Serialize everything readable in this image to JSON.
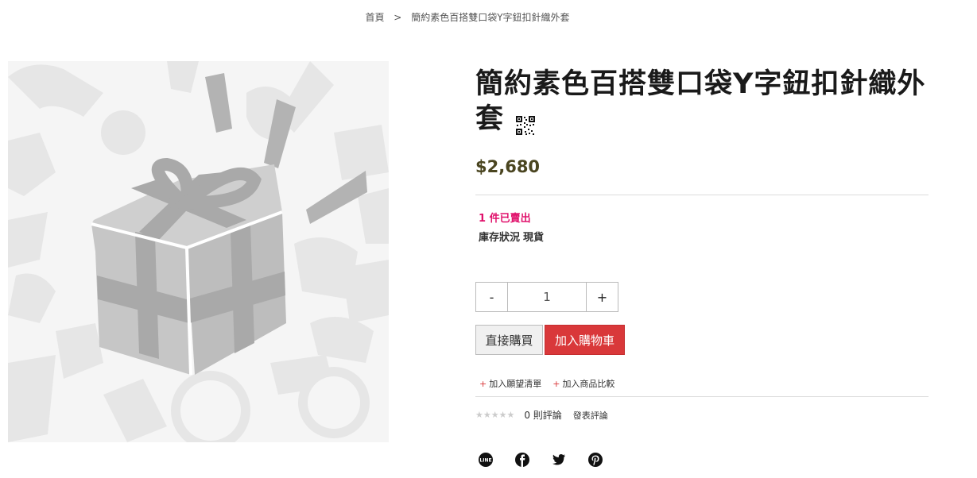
{
  "breadcrumb": {
    "home": "首頁",
    "separator": ">",
    "current": "簡約素色百搭雙口袋Y字鈕扣針織外套"
  },
  "product": {
    "title": "簡約素色百搭雙口袋Y字鈕扣針織外套",
    "price": "$2,680",
    "sold": "1 件已賣出",
    "stock_label": "庫存狀況",
    "stock_value": "現貨"
  },
  "quantity": {
    "minus": "-",
    "value": "1",
    "plus": "+"
  },
  "actions": {
    "buy_now": "直接購買",
    "add_to_cart": "加入購物車"
  },
  "links": {
    "wishlist": "加入願望清單",
    "compare": "加入商品比較",
    "plus_symbol": "+"
  },
  "reviews": {
    "stars": "★★★★★",
    "count": "0 則評論",
    "write": "發表評論"
  },
  "share": [
    "line-icon",
    "facebook-icon",
    "twitter-icon",
    "pinterest-icon"
  ],
  "colors": {
    "price": "#4a4520",
    "sold": "#e0116b",
    "cart_button": "#d9383a"
  }
}
